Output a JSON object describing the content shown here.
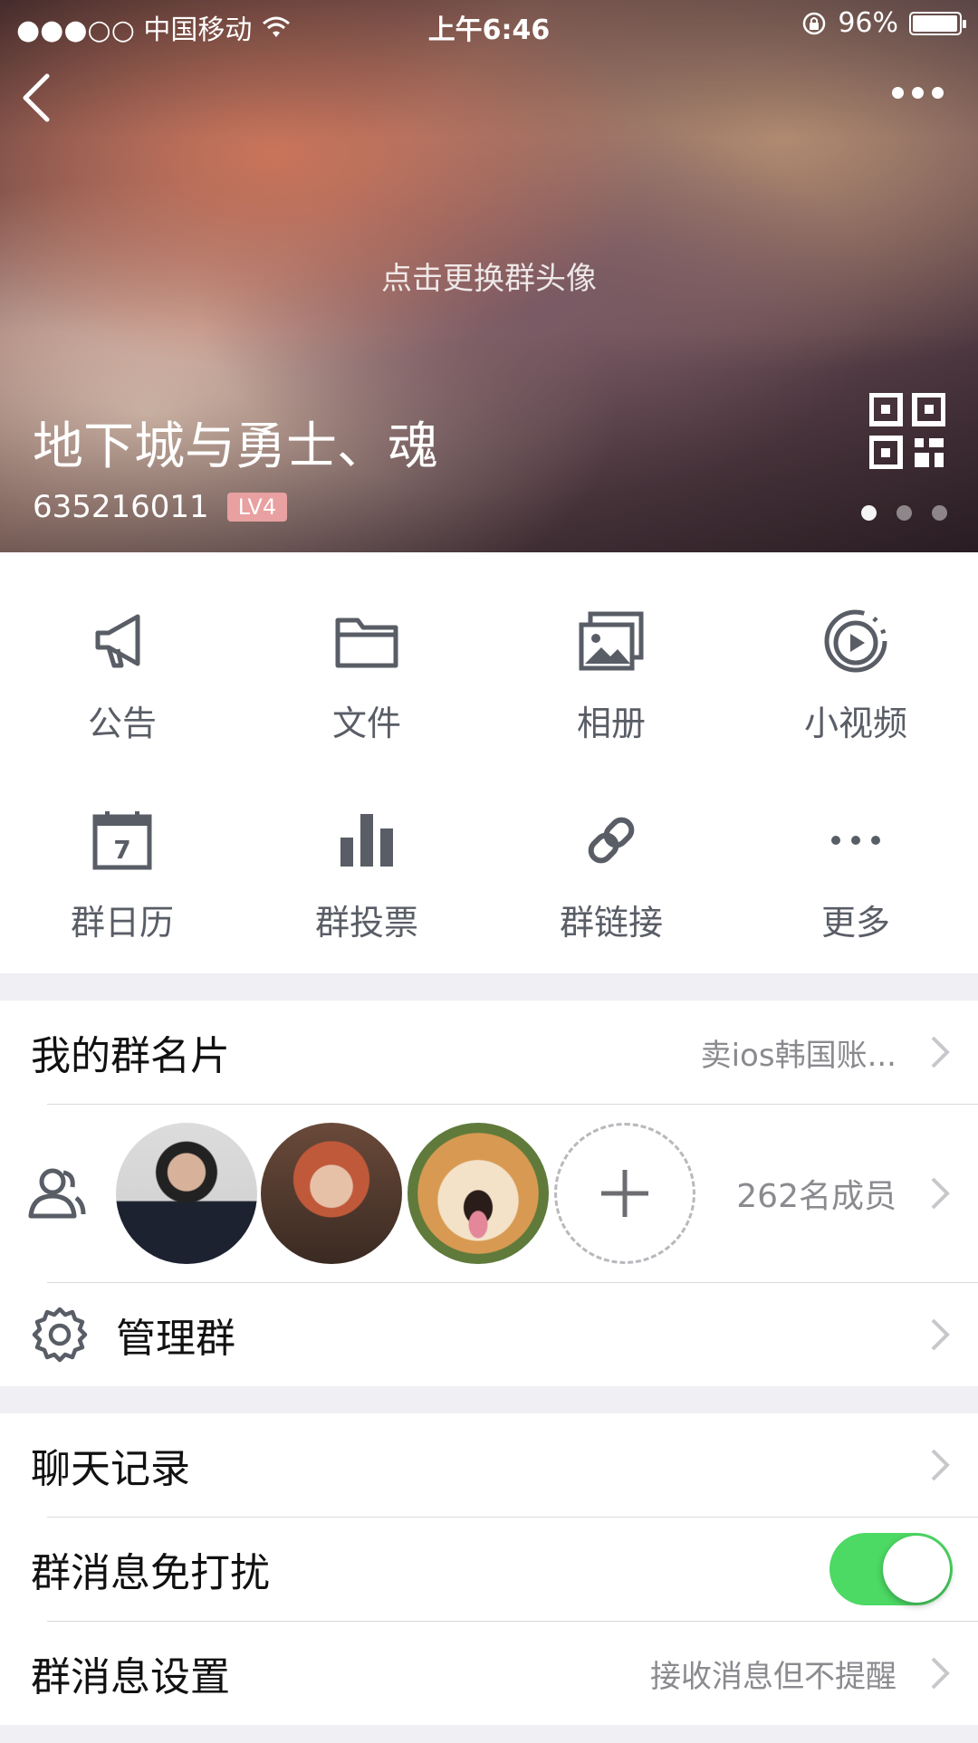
{
  "status_bar": {
    "carrier": "●●●○○ 中国移动",
    "time": "上午6:46",
    "battery": "96%"
  },
  "header": {
    "change_avatar_hint": "点击更换群头像",
    "group_name": "地下城与勇士、魂",
    "group_id": "635216011",
    "level_badge": "LV4",
    "page_dots": 3,
    "active_page_dot": 1
  },
  "features": [
    {
      "label": "公告",
      "icon": "megaphone-icon"
    },
    {
      "label": "文件",
      "icon": "folder-icon"
    },
    {
      "label": "相册",
      "icon": "album-icon"
    },
    {
      "label": "小视频",
      "icon": "video-play-icon"
    },
    {
      "label": "群日历",
      "icon": "calendar-icon",
      "calendar_day": "7"
    },
    {
      "label": "群投票",
      "icon": "bar-chart-icon"
    },
    {
      "label": "群链接",
      "icon": "link-icon"
    },
    {
      "label": "更多",
      "icon": "more-dots-icon"
    }
  ],
  "group_card": {
    "title": "我的群名片",
    "value": "卖ios韩国账..."
  },
  "members": {
    "count_text": "262名成员"
  },
  "manage": {
    "title": "管理群"
  },
  "chat_history": {
    "title": "聊天记录"
  },
  "do_not_disturb": {
    "title": "群消息免打扰",
    "enabled": true
  },
  "message_settings": {
    "title": "群消息设置",
    "value": "接收消息但不提醒"
  },
  "colors": {
    "toggle_on": "#4cd964",
    "icon_gray": "#595d66",
    "background": "#efeff4"
  }
}
